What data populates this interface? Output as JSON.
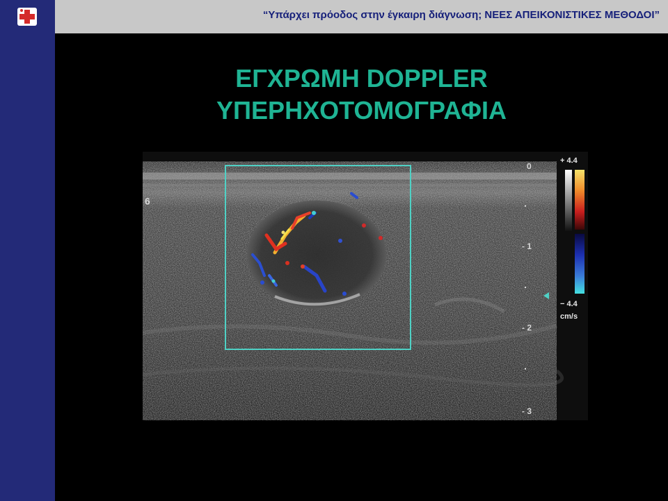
{
  "header": {
    "text": "“Υπάρχει πρόοδος στην έγκαιρη διάγνωση; ΝΕΕΣ ΑΠΕΙΚΟΝΙΣΤΙΚΕΣ ΜΕΘΟΔΟΙ”"
  },
  "slide": {
    "title_line1": "ΕΓΧΡΩΜΗ DOPPLER",
    "title_line2": "ΥΠΕΡΗΧΟΤΟΜΟΓΡΑΦΙΑ",
    "title_color": "#1fb494"
  },
  "ultrasound": {
    "side_label": "6",
    "scale_max": "+ 4.4",
    "scale_min": "− 4.4",
    "velocity_unit": "cm/s",
    "depth_labels": [
      "0",
      "- 1",
      "- 2",
      "- 3"
    ],
    "roi_color": "#4fd1c5"
  },
  "colors": {
    "sidebar": "#232a78",
    "header_bar": "#c8c8c8",
    "header_text": "#16207a",
    "logo_cross": "#d42a2a"
  }
}
